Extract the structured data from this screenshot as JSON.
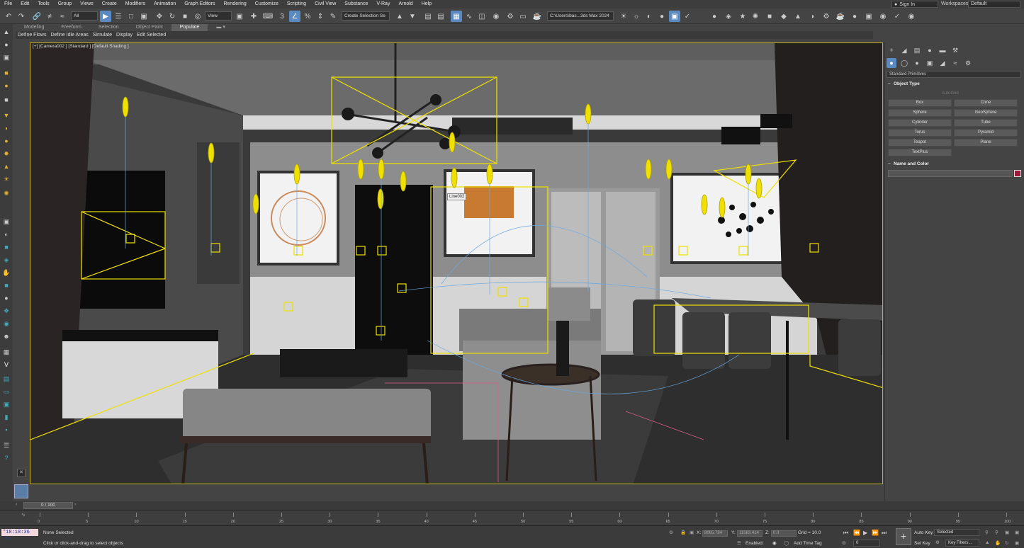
{
  "menu": [
    "File",
    "Edit",
    "Tools",
    "Group",
    "Views",
    "Create",
    "Modifiers",
    "Animation",
    "Graph Editors",
    "Rendering",
    "Customize",
    "Scripting",
    "Civil View",
    "Substance",
    "V-Ray",
    "Arnold",
    "Help"
  ],
  "account": {
    "sign_in": "Sign In",
    "workspaces_label": "Workspaces:",
    "workspace_value": "Default"
  },
  "toolbar": {
    "selection_filter": "All",
    "reference_coord": "View",
    "named_selection": "Create Selection Se",
    "project_path": "C:\\Users\\bas...3ds Max 2024"
  },
  "ribbon": {
    "tabs": [
      "Modeling",
      "Freeform",
      "Selection",
      "Object Paint",
      "Populate"
    ],
    "active_tab": "Populate",
    "subitems": [
      "Define Flows",
      "Define Idle Areas",
      "Simulate",
      "Display",
      "Edit Selected"
    ]
  },
  "viewport": {
    "label": "[+] [Camera002 ] [Standard ] [Default Shading ]",
    "tooltip": "Line002"
  },
  "command_panel": {
    "category": "Standard Primitives",
    "object_type_title": "Object Type",
    "autogrid": "AutoGrid",
    "primitives": [
      "Box",
      "Cone",
      "Sphere",
      "GeoSphere",
      "Cylinder",
      "Tube",
      "Torus",
      "Pyramid",
      "Teapot",
      "Plane",
      "TextPlus"
    ],
    "name_color_title": "Name and Color",
    "object_color": "#a0183a"
  },
  "timeline": {
    "frame_display": "0 / 100",
    "ticks": [
      0,
      5,
      10,
      15,
      20,
      25,
      30,
      35,
      40,
      45,
      50,
      55,
      60,
      65,
      70,
      75,
      80,
      85,
      90,
      95,
      100
    ]
  },
  "status": {
    "maxscript": "\"18:18:36 \">>",
    "selection": "None Selected",
    "prompt": "Click or click-and-drag to select objects",
    "x_label": "X:",
    "x_value": "8065.784",
    "y_label": "Y:",
    "y_value": "11563.414",
    "z_label": "Z:",
    "z_value": "0.0",
    "grid": "Grid = 10.0",
    "enabled_label": "Enabled:",
    "add_time_tag": "Add Time Tag",
    "auto_key": "Auto Key",
    "set_key": "Set Key",
    "selected_value": "Selected",
    "key_filters": "Key Filters...",
    "frame_value": "0"
  },
  "colors": {
    "accent": "#5a8ac0",
    "viewport_border": "#c8b020",
    "helper_yellow": "#f0e000"
  }
}
